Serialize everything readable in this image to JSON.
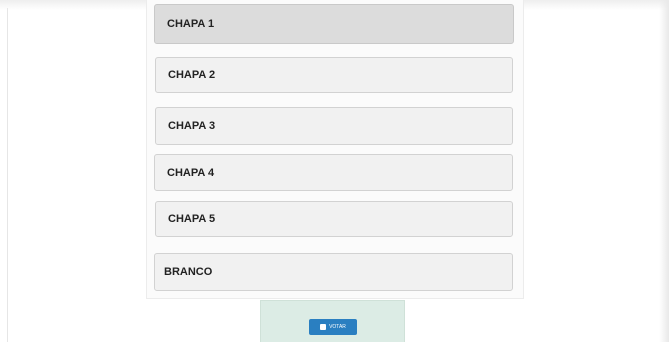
{
  "ballot": {
    "options": [
      {
        "label": "CHAPA 1",
        "selected": true
      },
      {
        "label": "CHAPA 2",
        "selected": false
      },
      {
        "label": "CHAPA 3",
        "selected": false
      },
      {
        "label": "CHAPA 4",
        "selected": false
      },
      {
        "label": "CHAPA 5",
        "selected": false
      },
      {
        "label": "BRANCO",
        "selected": false
      }
    ]
  },
  "vote": {
    "button_label": "VOTAR",
    "icon": "ballot-box-icon",
    "button_color": "#2a7fc1",
    "panel_color": "#dcece5"
  }
}
